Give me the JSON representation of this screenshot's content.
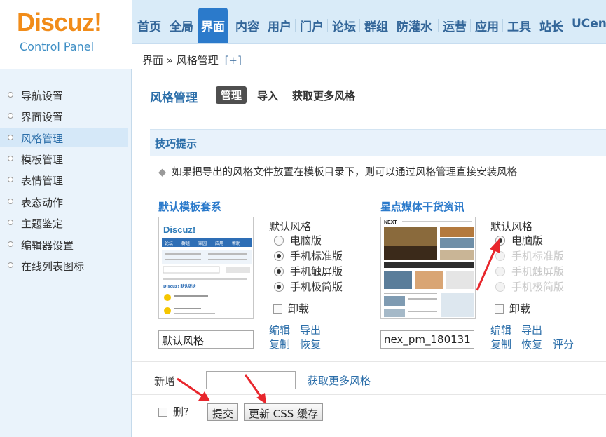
{
  "header": {
    "logo_text": "Discuz!",
    "logo_sub": "Control Panel",
    "nav": [
      {
        "label": "首页"
      },
      {
        "label": "全局"
      },
      {
        "label": "界面"
      },
      {
        "label": "内容"
      },
      {
        "label": "用户"
      },
      {
        "label": "门户"
      },
      {
        "label": "论坛"
      },
      {
        "label": "群组"
      },
      {
        "label": "防灌水"
      },
      {
        "label": "运营"
      },
      {
        "label": "应用"
      },
      {
        "label": "工具"
      },
      {
        "label": "站长"
      },
      {
        "label": "UCen"
      }
    ],
    "active_nav": "界面"
  },
  "breadcrumb": {
    "section": "界面",
    "sep": "»",
    "page": "风格管理",
    "plus": "[+]"
  },
  "sidebar": {
    "items": [
      {
        "label": "导航设置"
      },
      {
        "label": "界面设置"
      },
      {
        "label": "风格管理"
      },
      {
        "label": "模板管理"
      },
      {
        "label": "表情管理"
      },
      {
        "label": "表态动作"
      },
      {
        "label": "主题鉴定"
      },
      {
        "label": "编辑器设置"
      },
      {
        "label": "在线列表图标"
      }
    ],
    "active": "风格管理"
  },
  "main": {
    "title": "风格管理",
    "tabs": [
      {
        "label": "管理"
      },
      {
        "label": "导入"
      },
      {
        "label": "获取更多风格"
      }
    ],
    "active_tab": "管理",
    "tips_title": "技巧提示",
    "tip": "如果把导出的风格文件放置在模板目录下，则可以通过风格管理直接安装风格",
    "styles": [
      {
        "name": "默认模板套系",
        "default_label": "默认风格",
        "options": [
          "电脑版",
          "手机标准版",
          "手机触屏版",
          "手机极简版"
        ],
        "uninstall_label": "卸载",
        "input_value": "默认风格",
        "links": [
          "编辑",
          "导出",
          "复制",
          "恢复"
        ]
      },
      {
        "name": "星点媒体干货资讯",
        "default_label": "默认风格",
        "options": [
          "电脑版",
          "手机标准版",
          "手机触屏版",
          "手机极简版"
        ],
        "uninstall_label": "卸载",
        "input_value": "nex_pm_180131",
        "links": [
          "编辑",
          "导出",
          "复制",
          "恢复",
          "评分"
        ]
      }
    ],
    "new_label": "新增",
    "new_input_value": "",
    "get_more_link": "获取更多风格",
    "delete_label": "删?",
    "submit_label": "提交",
    "refresh_css_label": "更新 CSS 缓存"
  },
  "thumb1": {
    "logo": "Discuz!",
    "tabs": [
      "论坛",
      "群组",
      "家园",
      "应用",
      "帮助"
    ],
    "section": "Discuz! 默认版块"
  },
  "thumb2": {
    "brand": "NEXT"
  },
  "colors": {
    "brand_orange": "#f18c1a",
    "nav_active": "#2b7acb",
    "link": "#2b6ea9",
    "arrow": "#e8262c"
  }
}
